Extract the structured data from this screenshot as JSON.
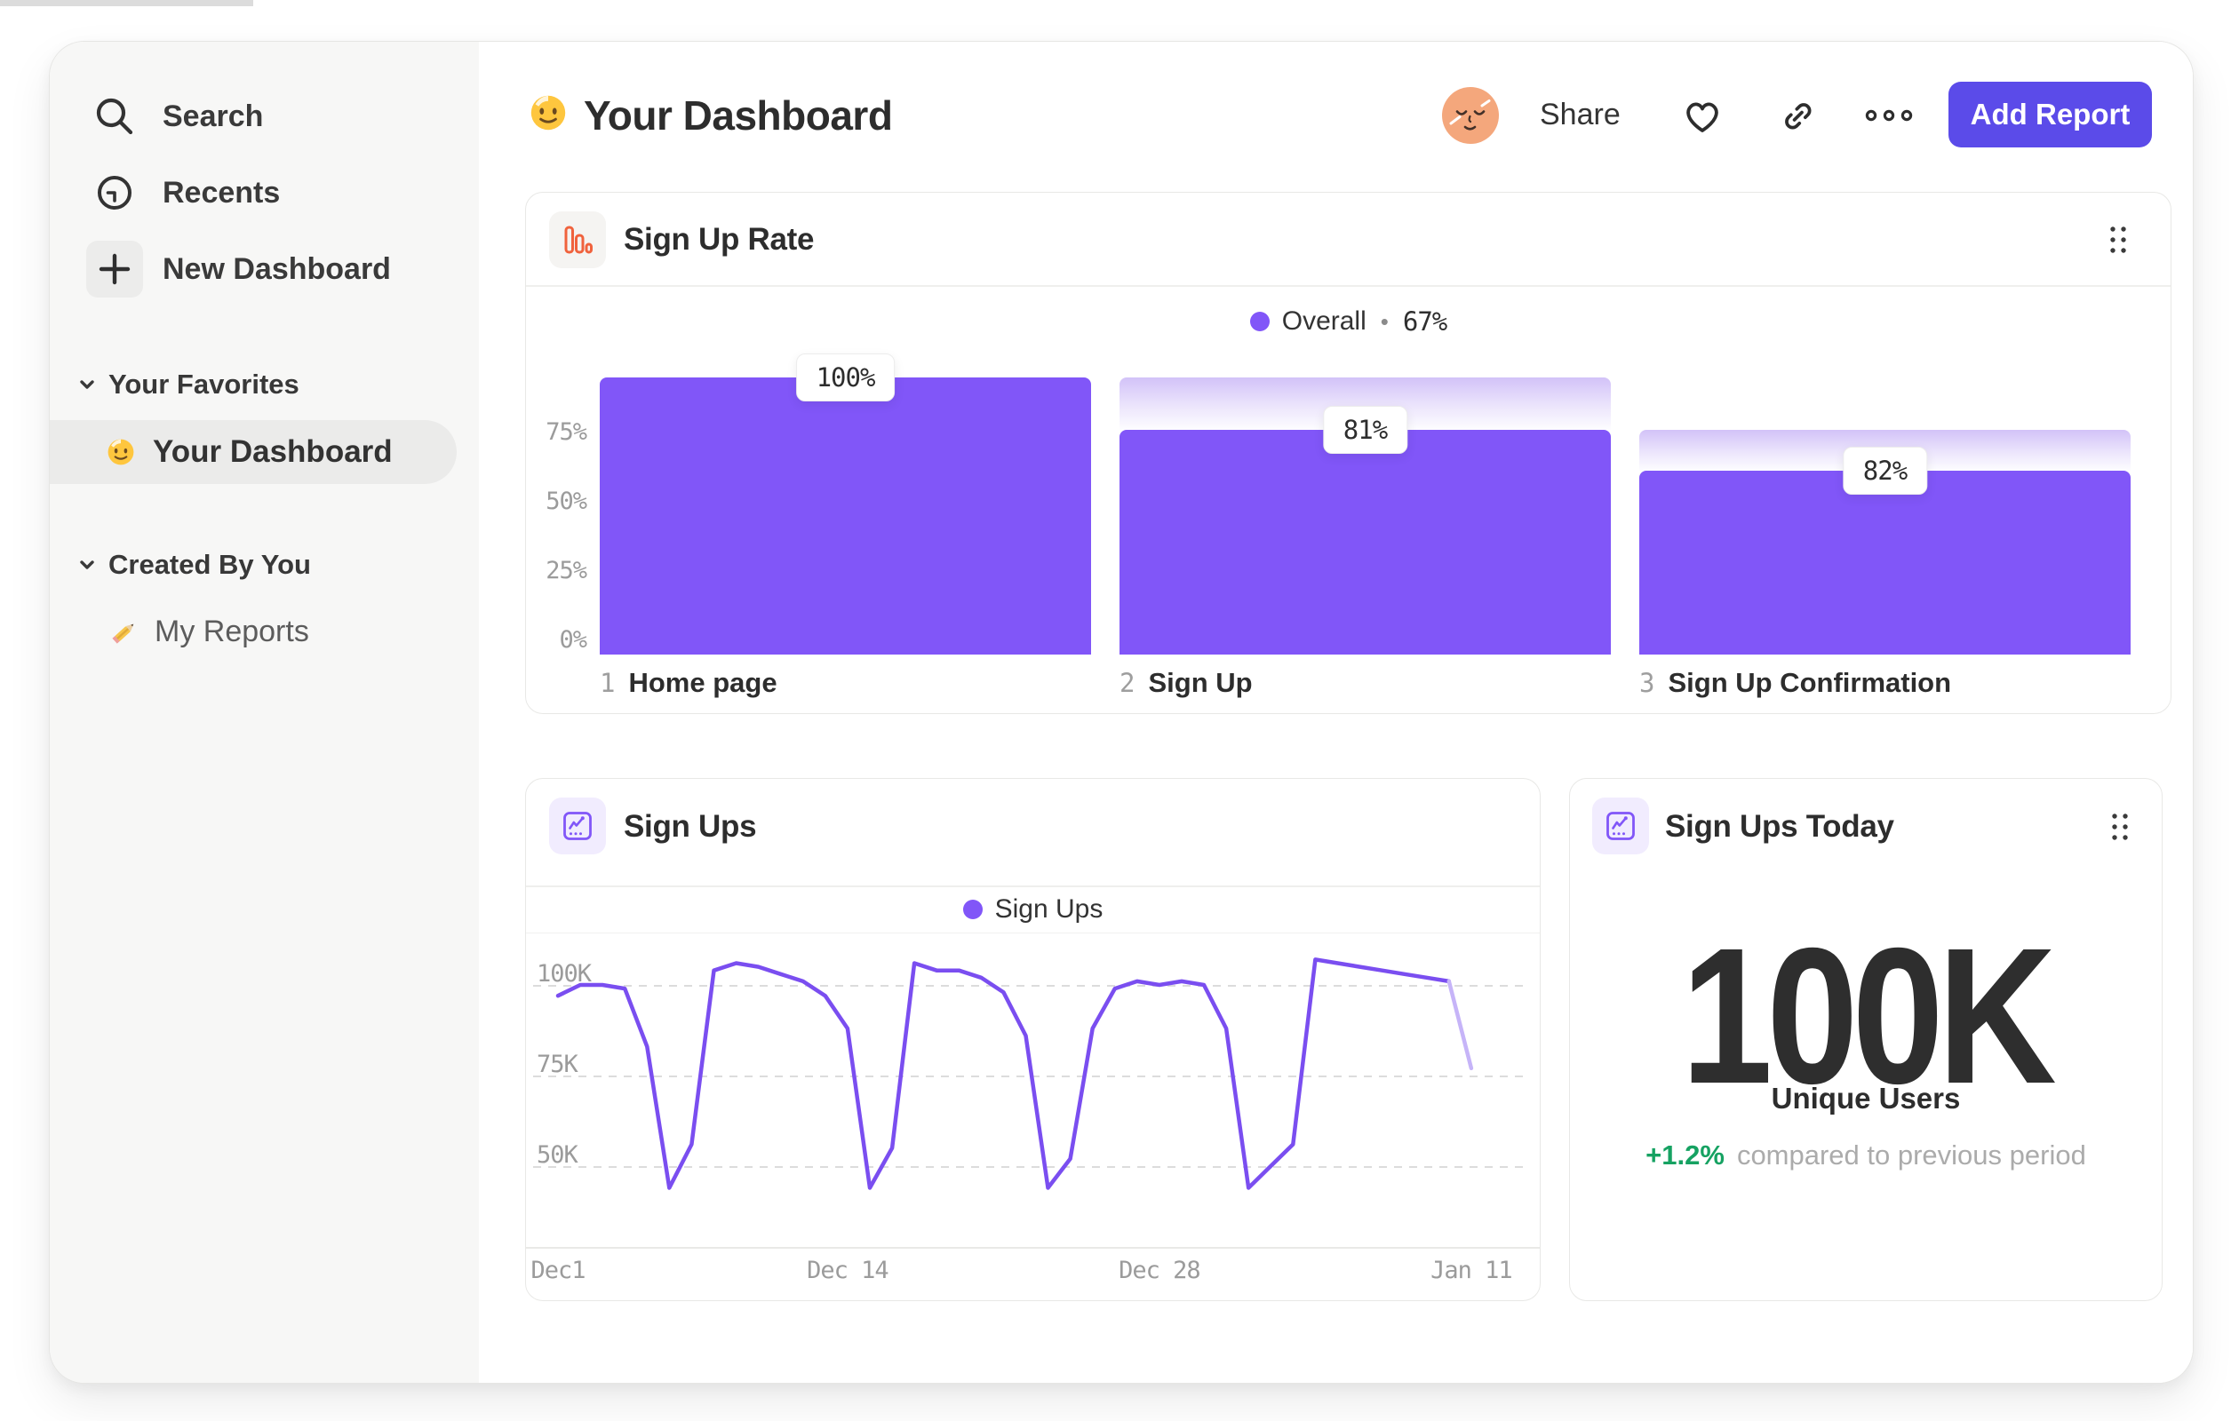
{
  "sidebar": {
    "nav": [
      {
        "label": "Search",
        "icon": "search-icon"
      },
      {
        "label": "Recents",
        "icon": "recents-clock-icon"
      },
      {
        "label": "New Dashboard",
        "icon": "plus-icon",
        "boxed": true
      }
    ],
    "sections": [
      {
        "label": "Your Favorites",
        "chevron": "chevron-down-icon",
        "items": [
          {
            "label": "Your Dashboard",
            "icon": "smiley-emoji-icon",
            "selected": true
          }
        ]
      },
      {
        "label": "Created By You",
        "chevron": "chevron-down-icon",
        "items": [
          {
            "label": "My Reports",
            "icon": "pencil-emoji-icon",
            "selected": false
          }
        ]
      }
    ]
  },
  "header": {
    "title": "Your Dashboard",
    "title_emoji": "smiley-emoji-icon",
    "avatar": "user-avatar",
    "share_label": "Share",
    "action_icons": [
      "heart-icon",
      "link-icon",
      "more-options-icon"
    ],
    "add_report_label": "Add Report"
  },
  "cards": {
    "funnel": {
      "title": "Sign Up Rate",
      "icon": "bar-chart-icon",
      "legend_name": "Overall",
      "legend_sep": "•",
      "legend_value": "67%"
    },
    "signups": {
      "title": "Sign Ups",
      "icon": "line-chart-icon",
      "legend_name": "Sign Ups"
    },
    "today": {
      "title": "Sign Ups Today",
      "icon": "line-chart-icon",
      "value": "100K",
      "caption": "Unique Users",
      "delta": "+1.2%",
      "delta_caption": "compared to previous period"
    }
  },
  "chart_data": [
    {
      "id": "sign-up-rate-funnel",
      "type": "bar",
      "title": "Sign Up Rate",
      "legend": "Overall • 67%",
      "legend_position": "top-center",
      "grid": false,
      "ylim_pct": [
        0,
        107
      ],
      "y_ticks": [
        {
          "label": "75%",
          "pct": 75
        },
        {
          "label": "50%",
          "pct": 50
        },
        {
          "label": "25%",
          "pct": 25
        },
        {
          "label": "0%",
          "pct": 0
        }
      ],
      "steps": [
        {
          "index": "1",
          "label": "Home page",
          "value_label": "100%",
          "conversion_pct": 100,
          "overall_pct": 100,
          "ghost_pct": null
        },
        {
          "index": "2",
          "label": "Sign Up",
          "value_label": "81%",
          "conversion_pct": 81,
          "overall_pct": 81,
          "ghost_pct": 100
        },
        {
          "index": "3",
          "label": "Sign Up Confirmation",
          "value_label": "82%",
          "conversion_pct": 82,
          "overall_pct": 66.4,
          "ghost_pct": 81
        }
      ]
    },
    {
      "id": "sign-ups-line",
      "type": "line",
      "title": "Sign Ups",
      "legend_position": "top-center",
      "grid": "dashed-horizontal",
      "ylim_k": [
        22,
        110
      ],
      "y_ticks": [
        {
          "label": "100K",
          "value": 100
        },
        {
          "label": "75K",
          "value": 75
        },
        {
          "label": "50K",
          "value": 50
        }
      ],
      "x_ticks": [
        {
          "label": "Dec1",
          "day": 0
        },
        {
          "label": "Dec 14",
          "day": 13
        },
        {
          "label": "Dec 28",
          "day": 27
        },
        {
          "label": "Jan 11",
          "day": 41
        }
      ],
      "series": [
        {
          "name": "Sign Ups",
          "values_k": [
            97,
            100,
            100,
            99,
            83,
            44,
            56,
            104,
            106,
            105,
            103,
            101,
            97,
            88,
            44,
            55,
            106,
            104,
            104,
            102,
            98,
            86,
            44,
            52,
            88,
            99,
            101,
            100,
            101,
            100,
            88,
            44,
            50,
            56,
            107,
            106,
            105,
            104,
            103,
            102,
            101,
            77
          ]
        }
      ],
      "faded_from_index": 40
    }
  ],
  "colors": {
    "accent_purple": "#8156f8",
    "line_purple": "#7a4ef0",
    "line_faded": "#c6b4f8",
    "button_purple": "#5b4be9",
    "icon_orange": "#f0623d",
    "positive_green": "#16a262",
    "sidebar_bg": "#f7f7f6",
    "selected_pill": "#ebebea",
    "card_border": "#e8e8e6",
    "ghost_gradient_top": "#d2c2f8"
  }
}
